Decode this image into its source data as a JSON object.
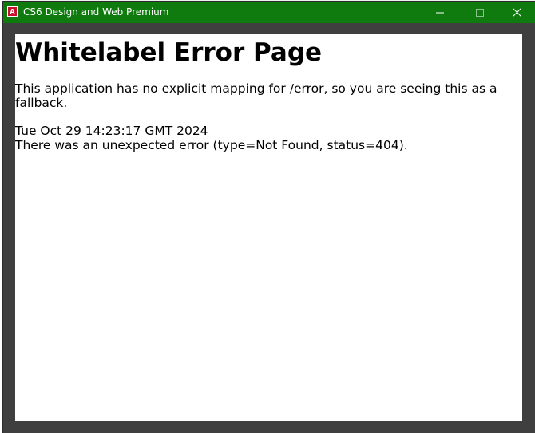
{
  "window": {
    "title": "CS6 Design and Web Premium",
    "icon": "adobe-icon",
    "icon_glyph": "A",
    "titlebar_color": "#0f7b0f",
    "frame_color": "#3f3f3f"
  },
  "page": {
    "heading": "Whitelabel Error Page",
    "message": "This application has no explicit mapping for /error, so you are seeing this as a fallback.",
    "timestamp": "Tue Oct 29 14:23:17 GMT 2024",
    "error_detail": "There was an unexpected error (type=Not Found, status=404)."
  }
}
